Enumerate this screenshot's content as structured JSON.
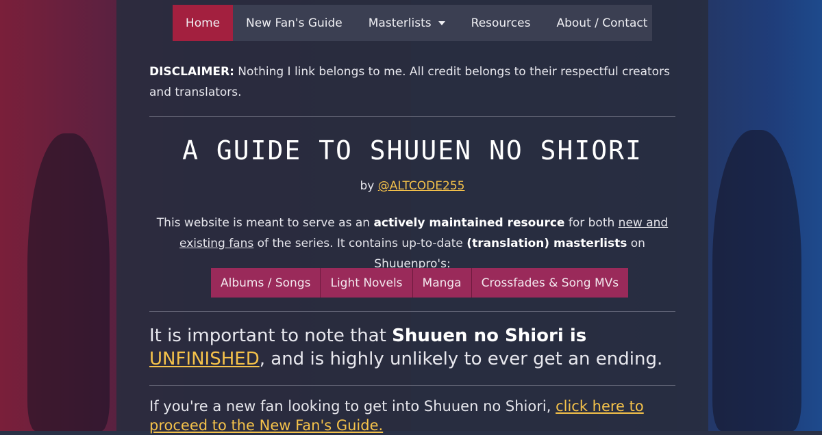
{
  "nav": {
    "items": [
      {
        "label": "Home",
        "active": true
      },
      {
        "label": "New Fan's Guide",
        "active": false
      },
      {
        "label": "Masterlists",
        "active": false,
        "dropdown": true
      },
      {
        "label": "Resources",
        "active": false
      },
      {
        "label": "About / Contact",
        "active": false
      }
    ]
  },
  "disclaimer": {
    "heading": "DISCLAIMER:",
    "text": " Nothing I link belongs to me. All credit belongs to their respectful creators and translators."
  },
  "hero": {
    "title": "A GUIDE TO SHUUEN NO SHIORI",
    "by_prefix": "by ",
    "author": "@ALTCODE255"
  },
  "intro": {
    "part1": "This website is meant to serve as an ",
    "bold1": "actively maintained resource",
    "part2": " for both ",
    "link": "new and existing fans",
    "part3": " of the series. It contains up-to-date ",
    "bold2": "(translation) masterlists",
    "part4": " on Shuuenpro's:"
  },
  "masterlists": [
    "Albums / Songs",
    "Light Novels",
    "Manga",
    "Crossfades & Song MVs"
  ],
  "notice": {
    "part1": "It is important to note that ",
    "bold": "Shuuen no Shiori is ",
    "link": "UNFINISHED",
    "part2": ", and is highly unlikely to ever get an ending."
  },
  "newfan": {
    "text": "If you're a new fan looking to get into Shuuen no Shiori, ",
    "link": "click here to proceed to the New Fan's Guide."
  },
  "colors": {
    "accent": "#a3203f",
    "pill": "#9a2a5a",
    "link": "#f5c24a"
  }
}
